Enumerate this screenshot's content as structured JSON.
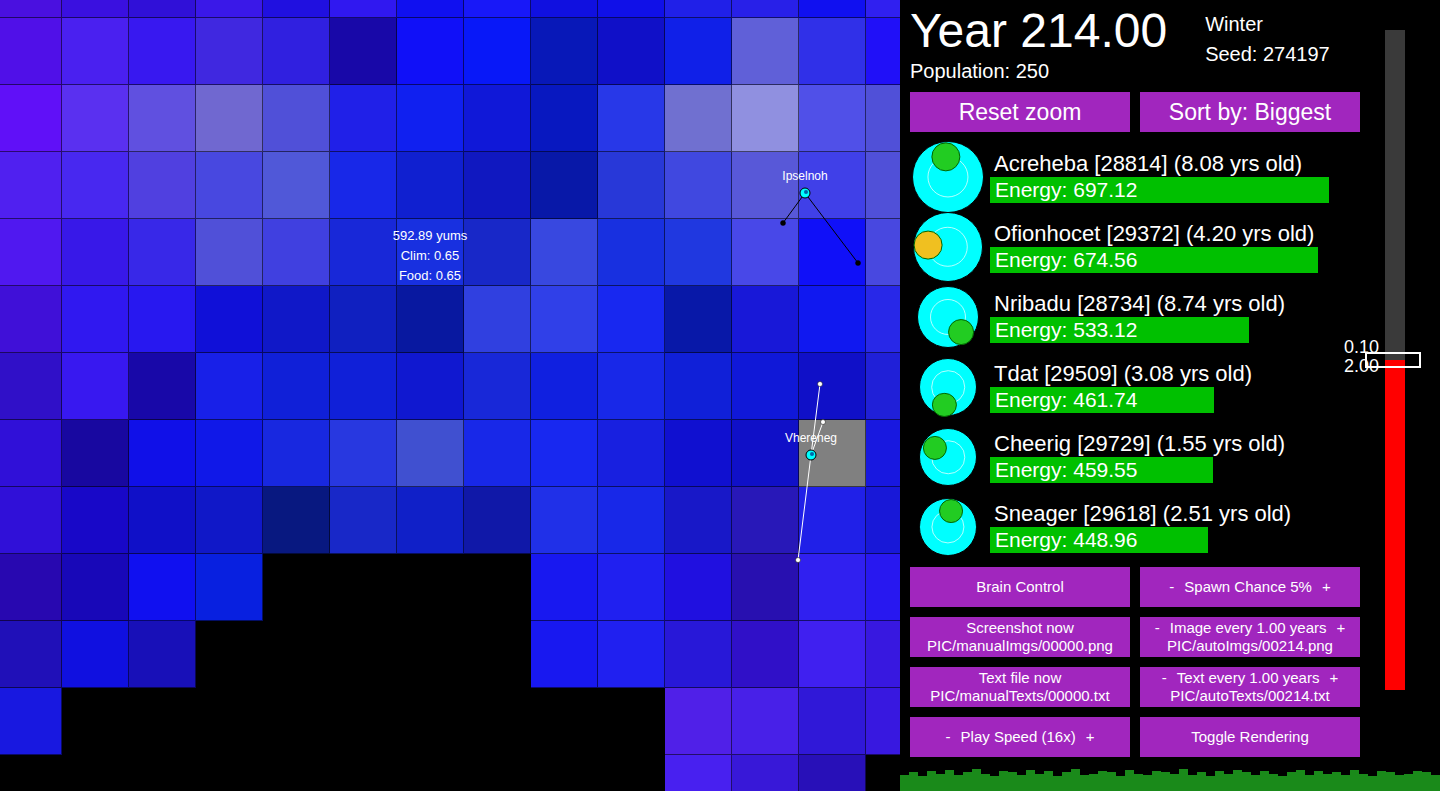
{
  "map": {
    "tiles": [
      [
        "#4a10e0",
        "#3a10e0",
        "#3010d8",
        "#3a18e8",
        "#2010e0",
        "#3018f0",
        "#1010f0",
        "#1818f8",
        "#1010e0",
        "#1010e8",
        "#2020e8",
        "#2820e8",
        "#1010f0",
        "#3020f0"
      ],
      [
        "#5010e8",
        "#4a20f0",
        "#3818f0",
        "#4028e0",
        "#3020e0",
        "#1808a8",
        "#1010f8",
        "#0818f8",
        "#0818b8",
        "#1010c8",
        "#1020e8",
        "#6060d8",
        "#3030e8",
        "#2010f8"
      ],
      [
        "#6010f8",
        "#5a30f0",
        "#6050e0",
        "#7068d0",
        "#5050d8",
        "#2020e8",
        "#1020f0",
        "#1018d8",
        "#0818c0",
        "#2838e8",
        "#7070d0",
        "#9090e0",
        "#5050e8",
        "#5050d8"
      ],
      [
        "#5020f0",
        "#4828f0",
        "#5040e0",
        "#4848e0",
        "#5058d8",
        "#1828e8",
        "#1020d0",
        "#1018c0",
        "#0818a8",
        "#2838d8",
        "#4048e0",
        "#5858d8",
        "#4040e8",
        "#5050d8"
      ],
      [
        "#5018f0",
        "#3818e8",
        "#3828e8",
        "#5050d8",
        "#4040e0",
        "#1828d8",
        "#1830e0",
        "#1828c8",
        "#3848e0",
        "#1830e0",
        "#2038e0",
        "#4848e8",
        "#1010f8",
        "#4848e0"
      ],
      [
        "#4010d8",
        "#3018f0",
        "#2818f0",
        "#1010d8",
        "#1018c8",
        "#1020c0",
        "#0818a0",
        "#3040e0",
        "#3040e8",
        "#1828f0",
        "#0818a8",
        "#1818d8",
        "#1018f0",
        "#2828e8"
      ],
      [
        "#3010c8",
        "#3818f0",
        "#1808a8",
        "#1820e8",
        "#1020d8",
        "#1020d8",
        "#1018d0",
        "#1828d8",
        "#1020e0",
        "#1828e8",
        "#1020d8",
        "#1018d8",
        "#1010c8",
        "#2020d8"
      ],
      [
        "#3010d8",
        "#1808a0",
        "#1010e8",
        "#1018e8",
        "#1828e0",
        "#2838e0",
        "#4050d0",
        "#1828e8",
        "#1828f0",
        "#1820e0",
        "#1010d0",
        "#1010c8",
        "#808080",
        "#1818e0"
      ],
      [
        "#3010d8",
        "#1808c8",
        "#1010c8",
        "#1018c8",
        "#081880",
        "#1828c8",
        "#1020c8",
        "#1018a8",
        "#2030e8",
        "#1828e8",
        "#1818c8",
        "#2818b8",
        "#2020e8",
        "#1818d8"
      ],
      [
        "#2808b0",
        "#1808b8",
        "#1010f0",
        "#0820e0",
        "#000000",
        "#000000",
        "#000000",
        "#000000",
        "#1818f0",
        "#2020f0",
        "#2010e0",
        "#2810b0",
        "#3020f0",
        "#2818f0"
      ],
      [
        "#2010b8",
        "#1010e0",
        "#1810b8",
        "#000000",
        "#000000",
        "#000000",
        "#000000",
        "#000000",
        "#1818f0",
        "#2020f0",
        "#2818d8",
        "#3010c8",
        "#4020f0",
        "#3818e0"
      ],
      [
        "#1818e0",
        "#000000",
        "#000000",
        "#000000",
        "#000000",
        "#000000",
        "#000000",
        "#000000",
        "#000000",
        "#000000",
        "#5020e8",
        "#4820e8",
        "#3018d8",
        "#3818e0"
      ],
      [
        "#000000",
        "#000000",
        "#000000",
        "#000000",
        "#000000",
        "#000000",
        "#000000",
        "#000000",
        "#000000",
        "#000000",
        "#4820f0",
        "#3818d8",
        "#2810b8",
        "#000000"
      ]
    ],
    "tile_info": [
      "592.89 yums",
      "Clim: 0.65",
      "Food: 0.65"
    ],
    "creatures": [
      {
        "name": "Ipselnoh",
        "color": "#000000"
      },
      {
        "name": "Vhereneg",
        "color": "#ffffff"
      }
    ]
  },
  "header": {
    "year": "Year 214.00",
    "season": "Winter",
    "seed": "Seed: 274197",
    "population": "Population: 250"
  },
  "top_buttons": [
    "Reset zoom",
    "Sort by: Biggest"
  ],
  "creatures": [
    {
      "name": "Acreheba [28814] (8.08 yrs old)",
      "energy": "Energy: 697.12",
      "level": 0.968,
      "color": "#22cc22",
      "facing": 262
    },
    {
      "name": "Ofionhocet [29372] (4.20 yrs old)",
      "energy": "Energy: 674.56",
      "level": 0.937,
      "color": "#f0c020",
      "facing": 188
    },
    {
      "name": "Nribadu [28734] (8.74 yrs old)",
      "energy": "Energy: 533.12",
      "level": 0.74,
      "color": "#22cc22",
      "facing": 50
    },
    {
      "name": "Tdat [29509] (3.08 yrs old)",
      "energy": "Energy: 461.74",
      "level": 0.641,
      "color": "#22cc22",
      "facing": 105
    },
    {
      "name": "Cheerig [29729] (1.55 yrs old)",
      "energy": "Energy: 459.55",
      "level": 0.638,
      "color": "#22cc22",
      "facing": 215
    },
    {
      "name": "Sneager [29618] (2.51 yrs old)",
      "energy": "Energy: 448.96",
      "level": 0.623,
      "color": "#22cc22",
      "facing": 278
    }
  ],
  "controls": [
    {
      "kind": "button",
      "label": "Brain Control"
    },
    {
      "kind": "stepper",
      "minus": "-",
      "label": "Spawn Chance 5%",
      "plus": "+"
    },
    {
      "kind": "button",
      "label": "Screenshot now",
      "sub": "PIC/manualImgs/00000.png"
    },
    {
      "kind": "stepper",
      "minus": "-",
      "label": "Image every 1.00 years",
      "plus": "+",
      "sub": "PIC/autoImgs/00214.png"
    },
    {
      "kind": "button",
      "label": "Text file now",
      "sub": "PIC/manualTexts/00000.txt"
    },
    {
      "kind": "stepper",
      "minus": "-",
      "label": "Text every 1.00 years",
      "plus": "+",
      "sub": "PIC/autoTexts/00214.txt"
    },
    {
      "kind": "stepper",
      "minus": "-",
      "label": "Play Speed (16x)",
      "plus": "+"
    },
    {
      "kind": "button",
      "label": "Toggle Rendering"
    }
  ],
  "slider": {
    "labels": [
      "0.10",
      "2.00"
    ],
    "level": 0.5
  },
  "population_chart": {
    "values": [
      14,
      16,
      13,
      17,
      15,
      18,
      14,
      16,
      19,
      15,
      13,
      17,
      16,
      14,
      18,
      15,
      17,
      13,
      16,
      19,
      14,
      15,
      17,
      16,
      13,
      18,
      15,
      14,
      17,
      16,
      15,
      19,
      14,
      16,
      13,
      17,
      15,
      18,
      16,
      14,
      17,
      15,
      13,
      16,
      18,
      14,
      17,
      15,
      16,
      14,
      18,
      15,
      13,
      17,
      16,
      14,
      15,
      17,
      16,
      14
    ]
  }
}
